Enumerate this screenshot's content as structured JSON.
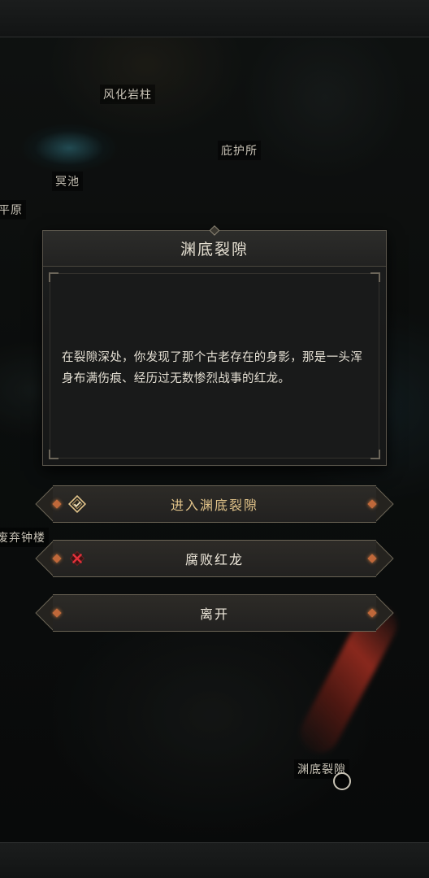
{
  "map": {
    "labels": [
      "风化岩柱",
      "庇护所",
      "冥池",
      "平原",
      "废弃钟楼",
      "渊底裂隙"
    ]
  },
  "dialog": {
    "title": "渊底裂隙",
    "text": "在裂隙深处，你发现了那个古老存在的身影，那是一头浑身布满伤痕、经历过无数惨烈战事的红龙。"
  },
  "options": [
    {
      "label": "进入渊底裂隙",
      "icon": "check-diamond-icon",
      "accent": "#e2c48a"
    },
    {
      "label": "腐败红龙",
      "icon": "red-cross-icon",
      "accent": "#d0303a"
    },
    {
      "label": "离开"
    }
  ]
}
